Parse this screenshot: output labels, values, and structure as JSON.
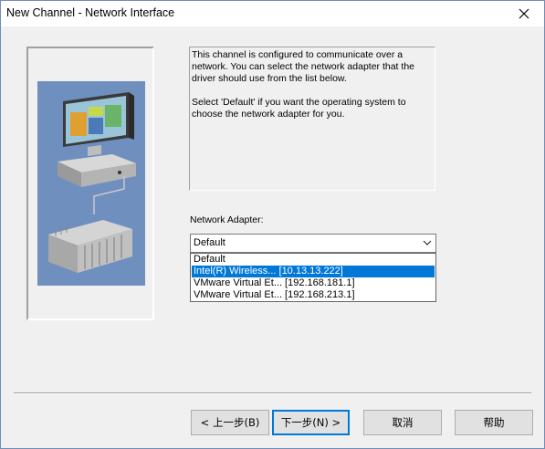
{
  "window": {
    "title": "New Channel - Network Interface"
  },
  "description": {
    "paragraph1": "This channel is configured to communicate over a network.  You can select the network adapter that the driver should use from the list below.",
    "paragraph2": "Select 'Default' if you want the operating system to choose the network adapter for you."
  },
  "adapter": {
    "label": "Network Adapter:",
    "selected": "Default",
    "options": [
      "Default",
      "Intel(R) Wireless... [10.13.13.222]",
      "VMware Virtual Et... [192.168.181.1]",
      "VMware Virtual Et... [192.168.213.1]"
    ],
    "highlighted_index": 1
  },
  "buttons": {
    "back": "< 上一步(B)",
    "next": "下一步(N) >",
    "cancel": "取消",
    "help": "帮助"
  },
  "colors": {
    "selection": "#0078d7",
    "illustration_bg": "#6f8fbf"
  }
}
